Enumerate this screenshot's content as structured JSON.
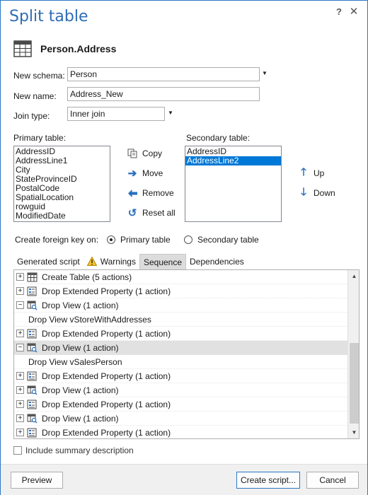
{
  "dialog": {
    "title": "Split table",
    "help": "?",
    "close": "✕"
  },
  "header": {
    "table_name": "Person.Address"
  },
  "form": {
    "schema_label": "New schema:",
    "schema_value": "Person",
    "name_label": "New name:",
    "name_value": "Address_New",
    "join_label": "Join type:",
    "join_value": "Inner join"
  },
  "primary": {
    "label": "Primary table:",
    "items": [
      "AddressID",
      "AddressLine1",
      "City",
      "StateProvinceID",
      "PostalCode",
      "SpatialLocation",
      "rowguid",
      "ModifiedDate"
    ]
  },
  "actions": {
    "copy": "Copy",
    "move": "Move",
    "remove": "Remove",
    "reset": "Reset all"
  },
  "secondary": {
    "label": "Secondary table:",
    "items": [
      "AddressID",
      "AddressLine2"
    ],
    "selected": "AddressLine2"
  },
  "order": {
    "up": "Up",
    "down": "Down"
  },
  "foreign_key": {
    "label": "Create foreign key on:",
    "primary": "Primary table",
    "secondary": "Secondary table",
    "selected": "Primary table"
  },
  "tabs": [
    {
      "label": "Generated script"
    },
    {
      "label": "Warnings"
    },
    {
      "label": "Sequence"
    },
    {
      "label": "Dependencies"
    }
  ],
  "active_tab": "Sequence",
  "sequence": [
    {
      "text": "Create Table (5 actions)",
      "kind": "table",
      "expander": "+"
    },
    {
      "text": "Drop Extended Property (1 action)",
      "kind": "prop",
      "expander": "+"
    },
    {
      "text": "Drop View (1 action)",
      "kind": "view",
      "expander": "−"
    },
    {
      "text": "Drop View vStoreWithAddresses",
      "kind": "child",
      "expander": ""
    },
    {
      "text": "Drop Extended Property (1 action)",
      "kind": "prop",
      "expander": "+"
    },
    {
      "text": "Drop View (1 action)",
      "kind": "view",
      "expander": "−",
      "highlighted": true
    },
    {
      "text": "Drop View vSalesPerson",
      "kind": "child",
      "expander": ""
    },
    {
      "text": "Drop Extended Property (1 action)",
      "kind": "prop",
      "expander": "+"
    },
    {
      "text": "Drop View (1 action)",
      "kind": "view",
      "expander": "+"
    },
    {
      "text": "Drop Extended Property (1 action)",
      "kind": "prop",
      "expander": "+"
    },
    {
      "text": "Drop View (1 action)",
      "kind": "view",
      "expander": "+"
    },
    {
      "text": "Drop Extended Property (1 action)",
      "kind": "prop",
      "expander": "+"
    }
  ],
  "include_summary": {
    "label": "Include summary description",
    "checked": false
  },
  "buttons": {
    "preview": "Preview",
    "create": "Create script...",
    "cancel": "Cancel"
  },
  "colors": {
    "accent": "#2e6db4",
    "selection": "#0078d7",
    "icon_blue": "#2a6fbf"
  }
}
